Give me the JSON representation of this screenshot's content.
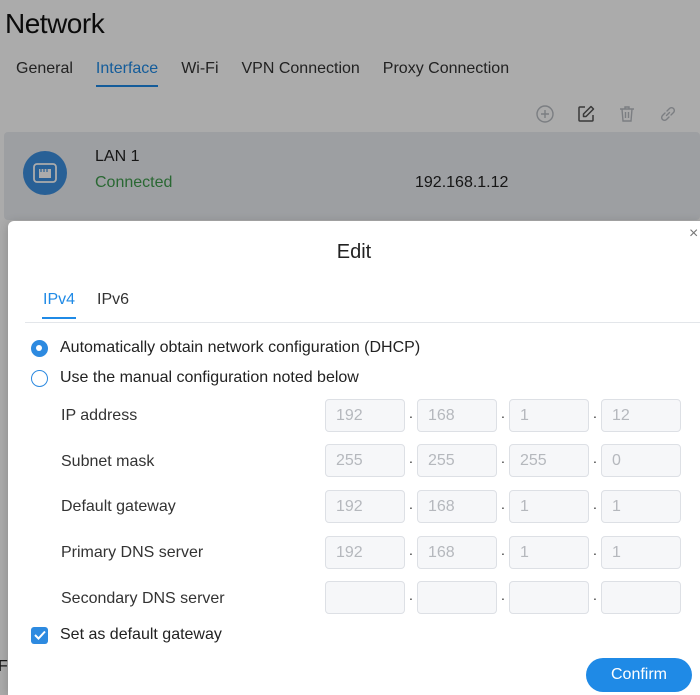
{
  "page": {
    "title": "Network",
    "tabs": [
      {
        "label": "General",
        "active": false
      },
      {
        "label": "Interface",
        "active": true
      },
      {
        "label": "Wi-Fi",
        "active": false
      },
      {
        "label": "VPN Connection",
        "active": false
      },
      {
        "label": "Proxy Connection",
        "active": false
      }
    ],
    "toolbar": [
      "add-icon",
      "edit-icon",
      "delete-icon",
      "link-icon"
    ],
    "interface": {
      "icon": "ethernet-port-icon",
      "name": "LAN 1",
      "status": "Connected",
      "ip": "192.168.1.12"
    },
    "fragment": "F"
  },
  "dialog": {
    "title": "Edit",
    "close_icon": "close-icon",
    "tabs": [
      {
        "label": "IPv4",
        "active": true
      },
      {
        "label": "IPv6",
        "active": false
      }
    ],
    "mode_options": [
      {
        "label": "Automatically obtain network configuration (DHCP)",
        "checked": true
      },
      {
        "label": "Use the manual configuration noted below",
        "checked": false
      }
    ],
    "fields": [
      {
        "label": "IP address",
        "octets": [
          "192",
          "168",
          "1",
          "12"
        ]
      },
      {
        "label": "Subnet mask",
        "octets": [
          "255",
          "255",
          "255",
          "0"
        ]
      },
      {
        "label": "Default gateway",
        "octets": [
          "192",
          "168",
          "1",
          "1"
        ]
      },
      {
        "label": "Primary DNS server",
        "octets": [
          "192",
          "168",
          "1",
          "1"
        ]
      },
      {
        "label": "Secondary DNS server",
        "octets": [
          "",
          "",
          "",
          ""
        ]
      }
    ],
    "default_gateway_checkbox": {
      "label": "Set as default gateway",
      "checked": true
    },
    "confirm_label": "Confirm"
  },
  "colors": {
    "accent": "#1f8ae6",
    "connected": "#3f9c4c",
    "row_bg": "#eaedf2"
  }
}
